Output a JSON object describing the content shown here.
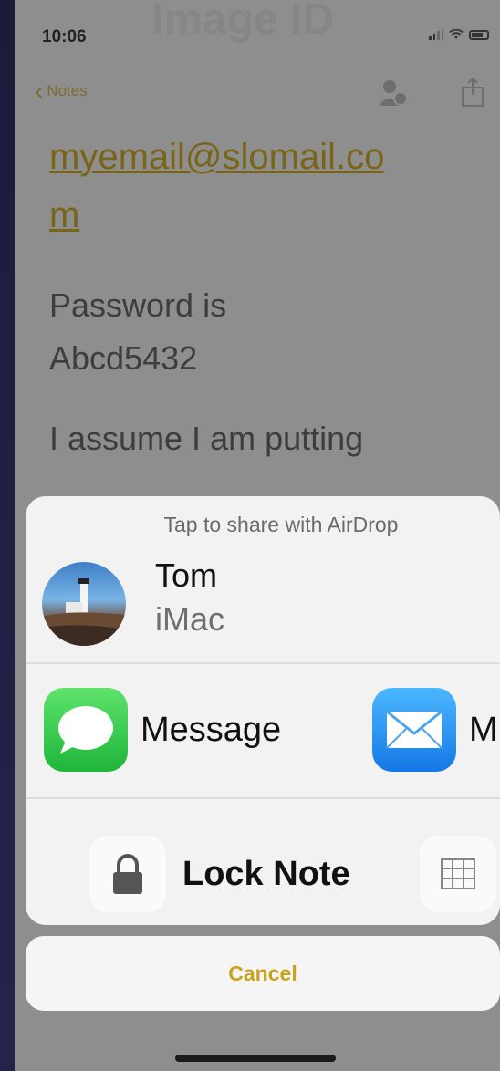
{
  "status_bar": {
    "time": "10:06"
  },
  "nav": {
    "back_label": "Notes"
  },
  "note": {
    "email_line1": "myemail@slomail.co",
    "email_line2": "m",
    "para_line1": "Password is",
    "para_line2": "Abcd5432",
    "para3": "I assume I am putting"
  },
  "share_sheet": {
    "airdrop_hint": "Tap to share with AirDrop",
    "contact": {
      "name": "Tom",
      "device": "iMac"
    },
    "apps": [
      {
        "label": "Message",
        "icon": "messages-icon"
      },
      {
        "label": "M",
        "icon": "mail-icon"
      }
    ],
    "actions": [
      {
        "label": "Lock Note",
        "icon": "lock-icon"
      },
      {
        "label": "",
        "icon": "table-icon"
      }
    ],
    "cancel_label": "Cancel"
  },
  "colors": {
    "accent": "#c9a21a",
    "link": "#7a6418",
    "sheet_bg": "#f2f2f2",
    "dim_bg": "#8e8e8e"
  }
}
